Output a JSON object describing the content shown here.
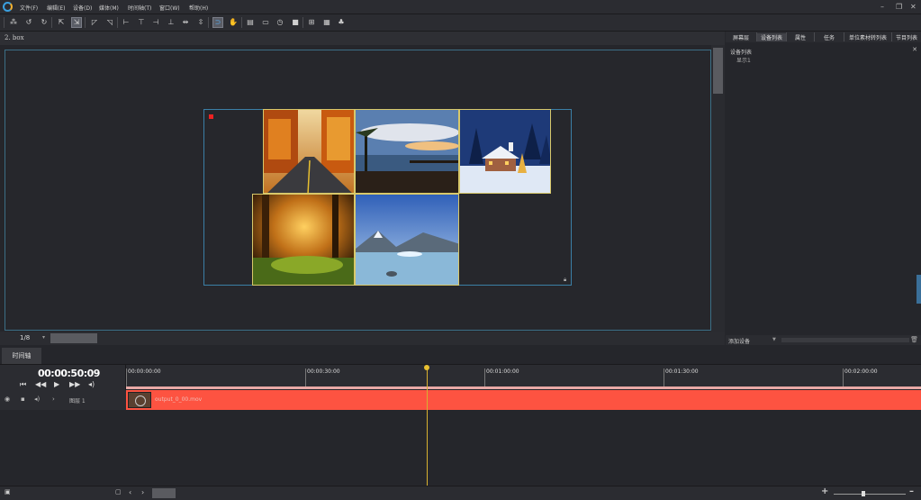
{
  "menu": {
    "items": [
      "文件(F)",
      "编辑(E)",
      "设备(D)",
      "媒体(M)",
      "时间轴(T)",
      "窗口(W)",
      "帮助(H)"
    ],
    "minimize": "–",
    "restore": "❐",
    "close": "✕"
  },
  "document": {
    "title": "2. box",
    "page_indicator": "1/8"
  },
  "right_panel": {
    "tabs": [
      "屏幕层",
      "设备列表",
      "属性",
      "任务",
      "单位素材转列表",
      "节目列表"
    ],
    "active_tab": "设备列表",
    "close": "✕",
    "list_title": "设备列表",
    "device_item": "显示1",
    "add_device": "添加设备"
  },
  "timeline": {
    "tab_label": "时间轴",
    "timecode": "00:00:50:09",
    "ruler_labels": [
      "00:00:00:00",
      "00:00:30:00",
      "00:01:00:00",
      "00:01:30:00",
      "00:02:00:00"
    ],
    "layer_label": "图层 1",
    "clip_name": "output_0_00.mov"
  },
  "colors": {
    "accent_blue": "#3b7fa6",
    "clip_red": "#fd5341",
    "playhead": "#d8b030",
    "photo_border": "#d8c86a"
  },
  "photos": [
    "autumn-road",
    "lake-pier-sunset",
    "snow-cabin-night",
    "sunlit-forest",
    "glacier-lake"
  ]
}
